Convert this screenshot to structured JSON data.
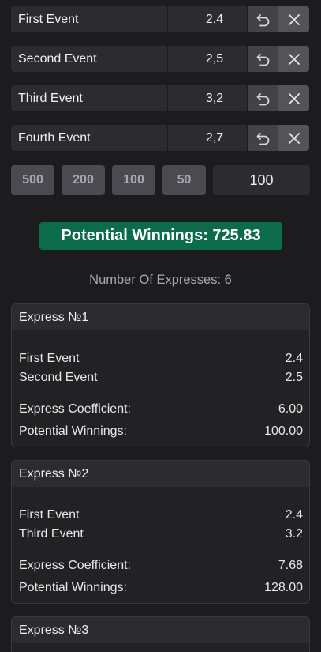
{
  "events": [
    {
      "name": "First Event",
      "coef": "2,4"
    },
    {
      "name": "Second Event",
      "coef": "2,5"
    },
    {
      "name": "Third Event",
      "coef": "3,2"
    },
    {
      "name": "Fourth Event",
      "coef": "2,7"
    }
  ],
  "amounts": [
    "500",
    "200",
    "100",
    "50"
  ],
  "stake": "100",
  "potential_winnings": "Potential Winnings: 725.83",
  "expresses_count": "Number Of Expresses: 6",
  "expresses": [
    {
      "title": "Express №1",
      "events": [
        {
          "name": "First Event",
          "coef": "2.4"
        },
        {
          "name": "Second Event",
          "coef": "2.5"
        }
      ],
      "coef_label": "Express Coefficient:",
      "coef_value": "6.00",
      "win_label": "Potential Winnings:",
      "win_value": "100.00"
    },
    {
      "title": "Express №2",
      "events": [
        {
          "name": "First Event",
          "coef": "2.4"
        },
        {
          "name": "Third Event",
          "coef": "3.2"
        }
      ],
      "coef_label": "Express Coefficient:",
      "coef_value": "7.68",
      "win_label": "Potential Winnings:",
      "win_value": "128.00"
    },
    {
      "title": "Express №3"
    }
  ]
}
